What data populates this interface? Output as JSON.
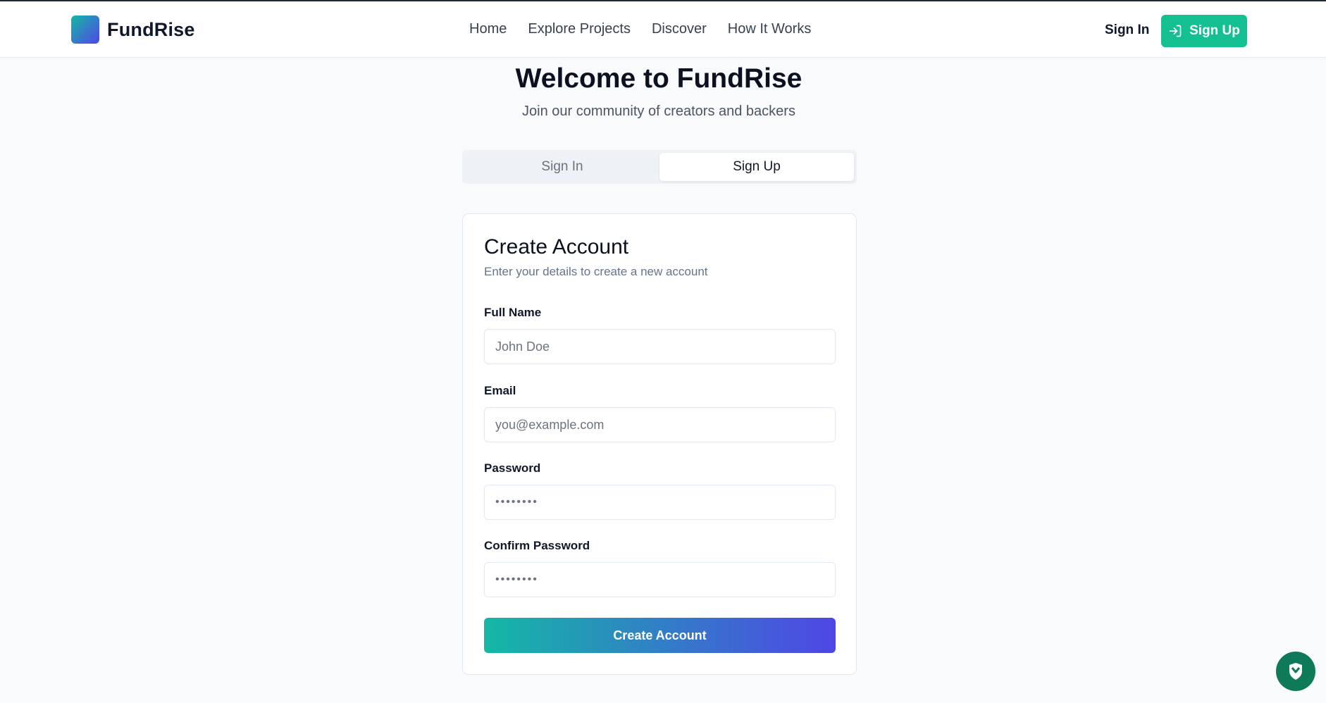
{
  "header": {
    "brand": "FundRise",
    "nav": [
      {
        "label": "Home"
      },
      {
        "label": "Explore Projects"
      },
      {
        "label": "Discover"
      },
      {
        "label": "How It Works"
      }
    ],
    "sign_in": "Sign In",
    "sign_up": "Sign Up",
    "sign_up_icon": "log-in-icon"
  },
  "hero": {
    "title": "Welcome to FundRise",
    "subtitle": "Join our community of creators and backers"
  },
  "tabs": [
    {
      "label": "Sign In",
      "active": false
    },
    {
      "label": "Sign Up",
      "active": true
    }
  ],
  "form": {
    "title": "Create Account",
    "subtitle": "Enter your details to create a new account",
    "fields": [
      {
        "label": "Full Name",
        "placeholder": "John Doe",
        "type": "text"
      },
      {
        "label": "Email",
        "placeholder": "you@example.com",
        "type": "email"
      },
      {
        "label": "Password",
        "placeholder": "••••••••",
        "type": "password"
      },
      {
        "label": "Confirm Password",
        "placeholder": "••••••••",
        "type": "password"
      }
    ],
    "submit": "Create Account"
  },
  "colors": {
    "accent": "#14c08f",
    "gradient_start": "#14b8a6",
    "gradient_end": "#4f46e5",
    "fab": "#0f7a5a"
  },
  "fab_icon": "shield-check-icon"
}
